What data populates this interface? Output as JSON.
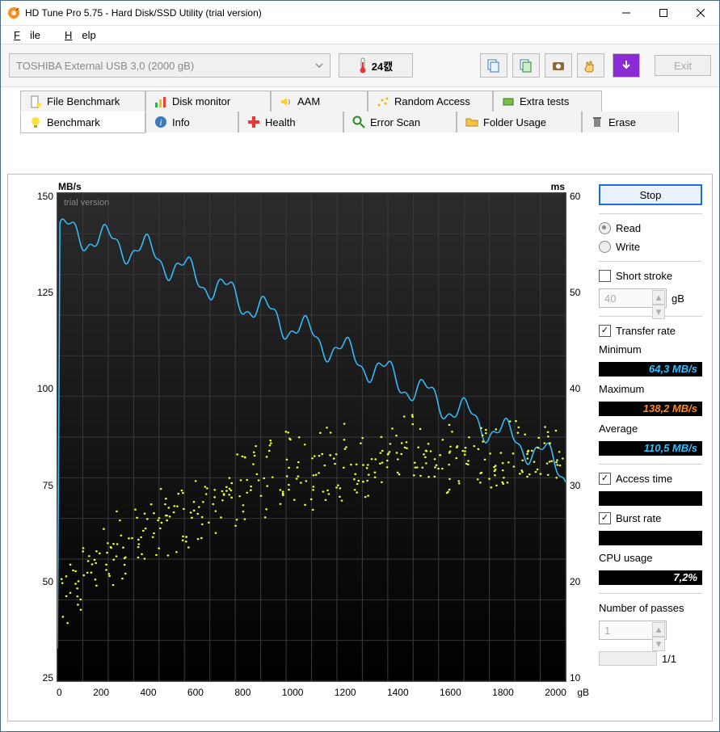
{
  "title": "HD Tune Pro 5.75 - Hard Disk/SSD Utility (trial version)",
  "menu": {
    "file": "File",
    "help": "Help"
  },
  "toolbar": {
    "drive": "TOSHIBA External USB 3,0 (2000 gB)",
    "temperature": "24캜",
    "exit": "Exit"
  },
  "tabs_top": [
    "File Benchmark",
    "Disk monitor",
    "AAM",
    "Random Access",
    "Extra tests"
  ],
  "tabs_bottom": [
    "Benchmark",
    "Info",
    "Health",
    "Error Scan",
    "Folder Usage",
    "Erase"
  ],
  "active_tab": "Benchmark",
  "side": {
    "stop": "Stop",
    "read": "Read",
    "write": "Write",
    "short_stroke_label": "Short stroke",
    "short_stroke_value": "40",
    "short_stroke_unit": "gB",
    "transfer_rate_label": "Transfer rate",
    "min_label": "Minimum",
    "min_value": "64,3 MB/s",
    "max_label": "Maximum",
    "max_value": "138,2 MB/s",
    "avg_label": "Average",
    "avg_value": "110,5 MB/s",
    "access_time_label": "Access time",
    "access_time_value": "",
    "burst_label": "Burst rate",
    "burst_value": "",
    "cpu_label": "CPU usage",
    "cpu_value": "7,2%",
    "passes_label": "Number of passes",
    "passes_value": "1",
    "passes_progress": "1/1"
  },
  "chart_data": {
    "type": "line+scatter",
    "title": "",
    "watermark": "trial version",
    "x_unit": "gB",
    "y_left_unit": "MB/s",
    "y_right_unit": "ms",
    "x_ticks": [
      "0",
      "200",
      "400",
      "600",
      "800",
      "1000",
      "1200",
      "1400",
      "1600",
      "1800",
      "2000"
    ],
    "y_left_ticks": [
      "150",
      "125",
      "100",
      "75",
      "50",
      "25"
    ],
    "y_right_ticks": [
      "60",
      "50",
      "40",
      "30",
      "20",
      "10"
    ],
    "x_range": [
      0,
      2000
    ],
    "y_left_range": [
      0,
      150
    ],
    "y_right_range": [
      0,
      60
    ],
    "series": [
      {
        "name": "Transfer rate (MB/s)",
        "axis": "left",
        "type": "line",
        "color": "#34bfff",
        "x": [
          0,
          50,
          100,
          150,
          200,
          250,
          300,
          350,
          400,
          450,
          500,
          550,
          600,
          650,
          700,
          750,
          800,
          850,
          900,
          950,
          1000,
          1050,
          1100,
          1150,
          1200,
          1250,
          1300,
          1350,
          1400,
          1450,
          1500,
          1550,
          1600,
          1650,
          1700,
          1750,
          1800,
          1850,
          1900,
          1950,
          2000
        ],
        "y": [
          138,
          138,
          137,
          136,
          135,
          134,
          133,
          132,
          130,
          128,
          126,
          124,
          122,
          120,
          118,
          116,
          114,
          112,
          110,
          108,
          106,
          104,
          102,
          100,
          98,
          96,
          94,
          92,
          90,
          88,
          86,
          84,
          82,
          80,
          78,
          76,
          74,
          72,
          70,
          67,
          64
        ]
      },
      {
        "name": "Access time (ms)",
        "axis": "right",
        "type": "scatter",
        "color": "#e8ff3a",
        "x": [
          30,
          60,
          90,
          120,
          150,
          180,
          210,
          240,
          270,
          300,
          330,
          360,
          390,
          420,
          450,
          480,
          510,
          540,
          570,
          600,
          630,
          660,
          690,
          720,
          750,
          780,
          810,
          840,
          870,
          900,
          930,
          960,
          990,
          1020,
          1050,
          1080,
          1110,
          1140,
          1170,
          1200,
          1230,
          1260,
          1290,
          1320,
          1350,
          1380,
          1410,
          1440,
          1470,
          1500,
          1530,
          1560,
          1590,
          1620,
          1650,
          1680,
          1710,
          1740,
          1770,
          1800,
          1830,
          1860,
          1890,
          1920,
          1950,
          1980
        ],
        "y": [
          10,
          12,
          11,
          15,
          13,
          16,
          14,
          18,
          15,
          19,
          16,
          20,
          17,
          21,
          18,
          22,
          19,
          23,
          20,
          22,
          21,
          24,
          22,
          25,
          22,
          26,
          23,
          27,
          23,
          28,
          24,
          27,
          24,
          28,
          25,
          29,
          25,
          29,
          26,
          27,
          25,
          28,
          26,
          29,
          27,
          30,
          26,
          29,
          27,
          28,
          26,
          29,
          27,
          28,
          27,
          29,
          26,
          28,
          27,
          29,
          26,
          28,
          27,
          29,
          28,
          29
        ]
      }
    ]
  }
}
